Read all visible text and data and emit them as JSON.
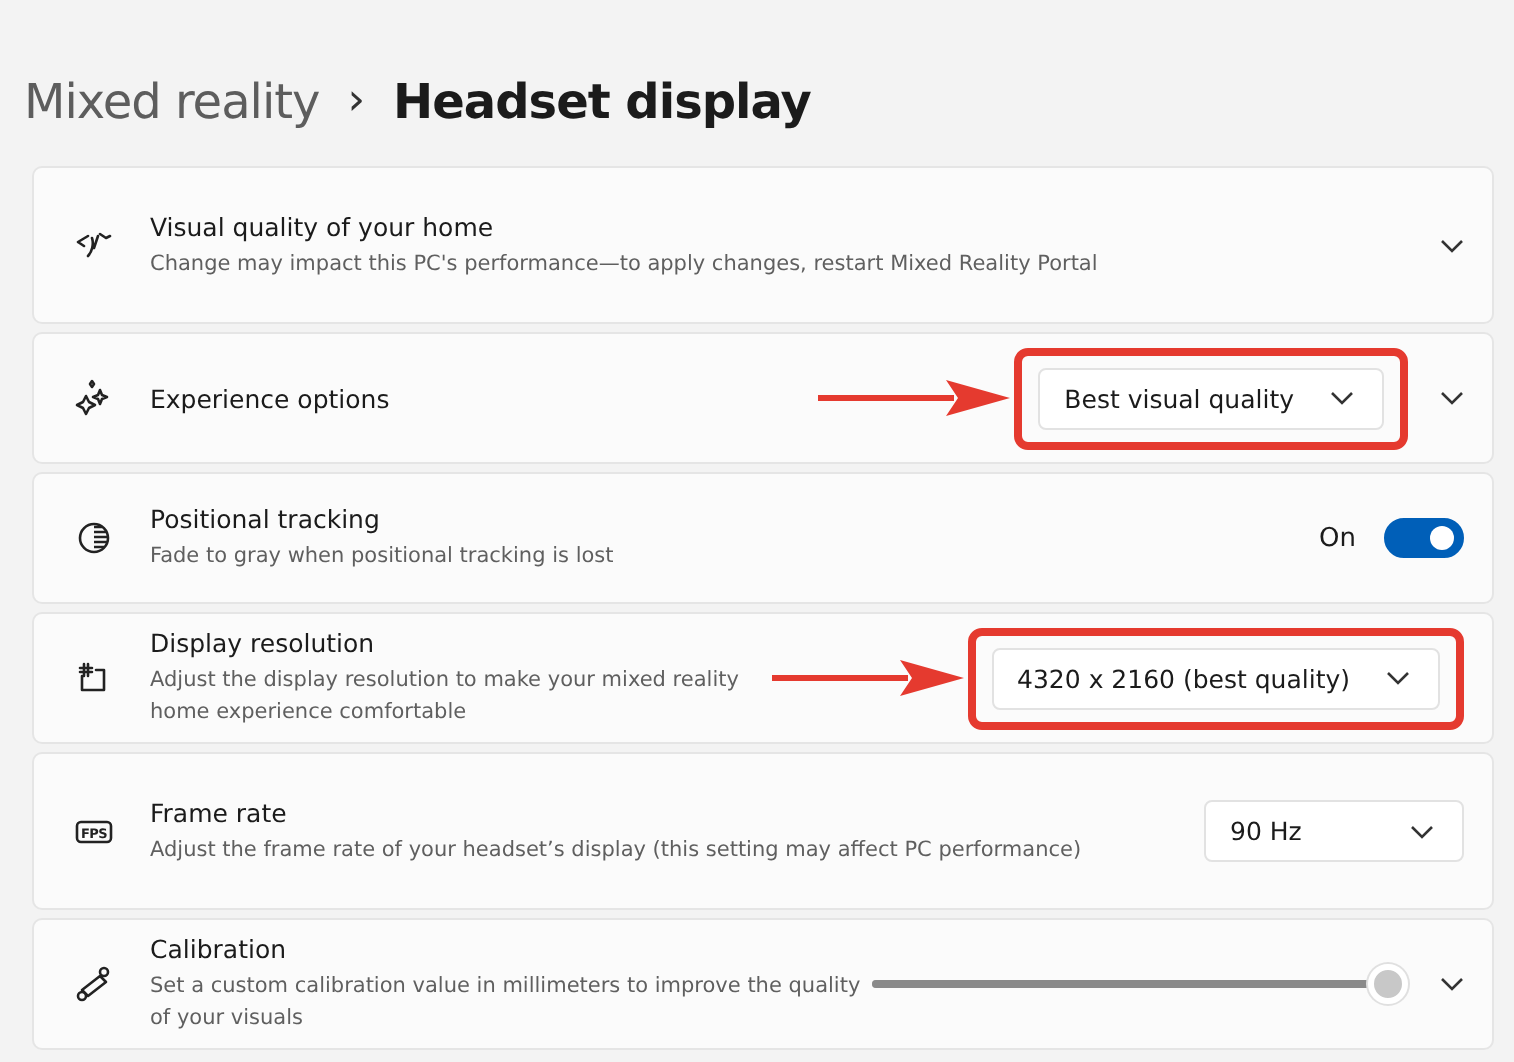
{
  "breadcrumb": {
    "parent": "Mixed reality",
    "separator": "›",
    "current": "Headset display"
  },
  "settings": [
    {
      "title": "Visual quality of your home",
      "description": "Change may impact this PC's performance—to apply changes, restart Mixed Reality Portal",
      "kind": "expander",
      "expanded": false
    },
    {
      "title": "Experience options",
      "kind": "dropdown",
      "value": "Best visual quality",
      "annotated": true,
      "expandable": true,
      "expanded": false
    },
    {
      "title": "Positional tracking",
      "description": "Fade to gray when positional tracking is lost",
      "kind": "toggle",
      "on": true,
      "state_label": "On"
    },
    {
      "title": "Display resolution",
      "description": "Adjust the display resolution to make your mixed reality home experience comfortable",
      "kind": "dropdown",
      "value": "4320 x 2160 (best quality)",
      "annotated": true
    },
    {
      "icon_label": "FPS",
      "title": "Frame rate",
      "description": "Adjust the frame rate of your headset’s display (this setting may affect PC performance)",
      "kind": "dropdown",
      "value": "90 Hz"
    },
    {
      "title": "Calibration",
      "description": "Set a custom calibration value in millimeters to improve the quality of your visuals",
      "kind": "slider",
      "level": 1.0,
      "expandable": true,
      "expanded": false
    }
  ]
}
